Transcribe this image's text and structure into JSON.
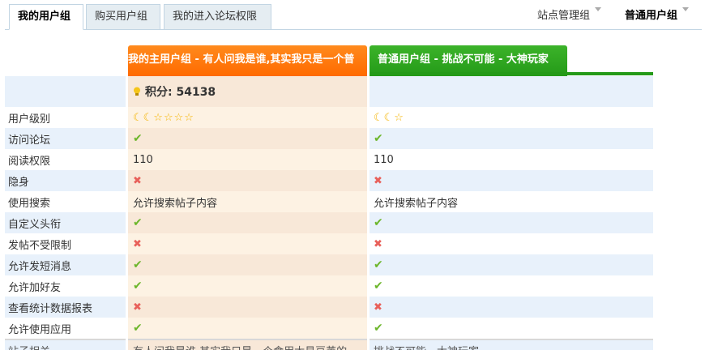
{
  "tabs": [
    {
      "label": "我的用户组",
      "active": true
    },
    {
      "label": "购买用户组",
      "active": false
    },
    {
      "label": "我的进入论坛权限",
      "active": false
    }
  ],
  "right_tabs": [
    {
      "label": "站点管理组"
    },
    {
      "label": "普通用户组"
    }
  ],
  "groups": {
    "main": {
      "header": "我的主用户组 - 有人问我是谁,其实我只是一个普"
    },
    "other": {
      "header": "普通用户组 - 挑战不可能 - 大神玩家"
    }
  },
  "points": {
    "label": "积分: 54138"
  },
  "rows": [
    {
      "label": "用户级别",
      "main": "☾☾☆☆☆☆",
      "other": "☾☾☆"
    },
    {
      "label": "访问论坛",
      "main": "✔",
      "other": "✔"
    },
    {
      "label": "阅读权限",
      "main": "110",
      "other": "110"
    },
    {
      "label": "隐身",
      "main": "✖",
      "other": "✖"
    },
    {
      "label": "使用搜索",
      "main": "允许搜索帖子内容",
      "other": "允许搜索帖子内容"
    },
    {
      "label": "自定义头衔",
      "main": "✔",
      "other": "✔"
    },
    {
      "label": "发帖不受限制",
      "main": "✖",
      "other": "✖"
    },
    {
      "label": "允许发短消息",
      "main": "✔",
      "other": "✔"
    },
    {
      "label": "允许加好友",
      "main": "✔",
      "other": "✔"
    },
    {
      "label": "查看统计数据报表",
      "main": "✖",
      "other": "✖"
    },
    {
      "label": "允许使用应用",
      "main": "✔",
      "other": "✔"
    },
    {
      "label": "站子相关",
      "main": "有人问我是谁,其实我只是一个食用太易豆荚的",
      "other": "挑战不可能 - 大神玩家"
    }
  ],
  "colors": {
    "orange_header": "#ff7a0a",
    "green_header": "#2ea61f",
    "check": "#6cb62b",
    "cross": "#e8605a",
    "star": "#f5b400"
  },
  "icons": {
    "points": "lightbulb-icon",
    "yes": "check-icon",
    "no": "cross-icon",
    "level": "moon-star-icons"
  }
}
